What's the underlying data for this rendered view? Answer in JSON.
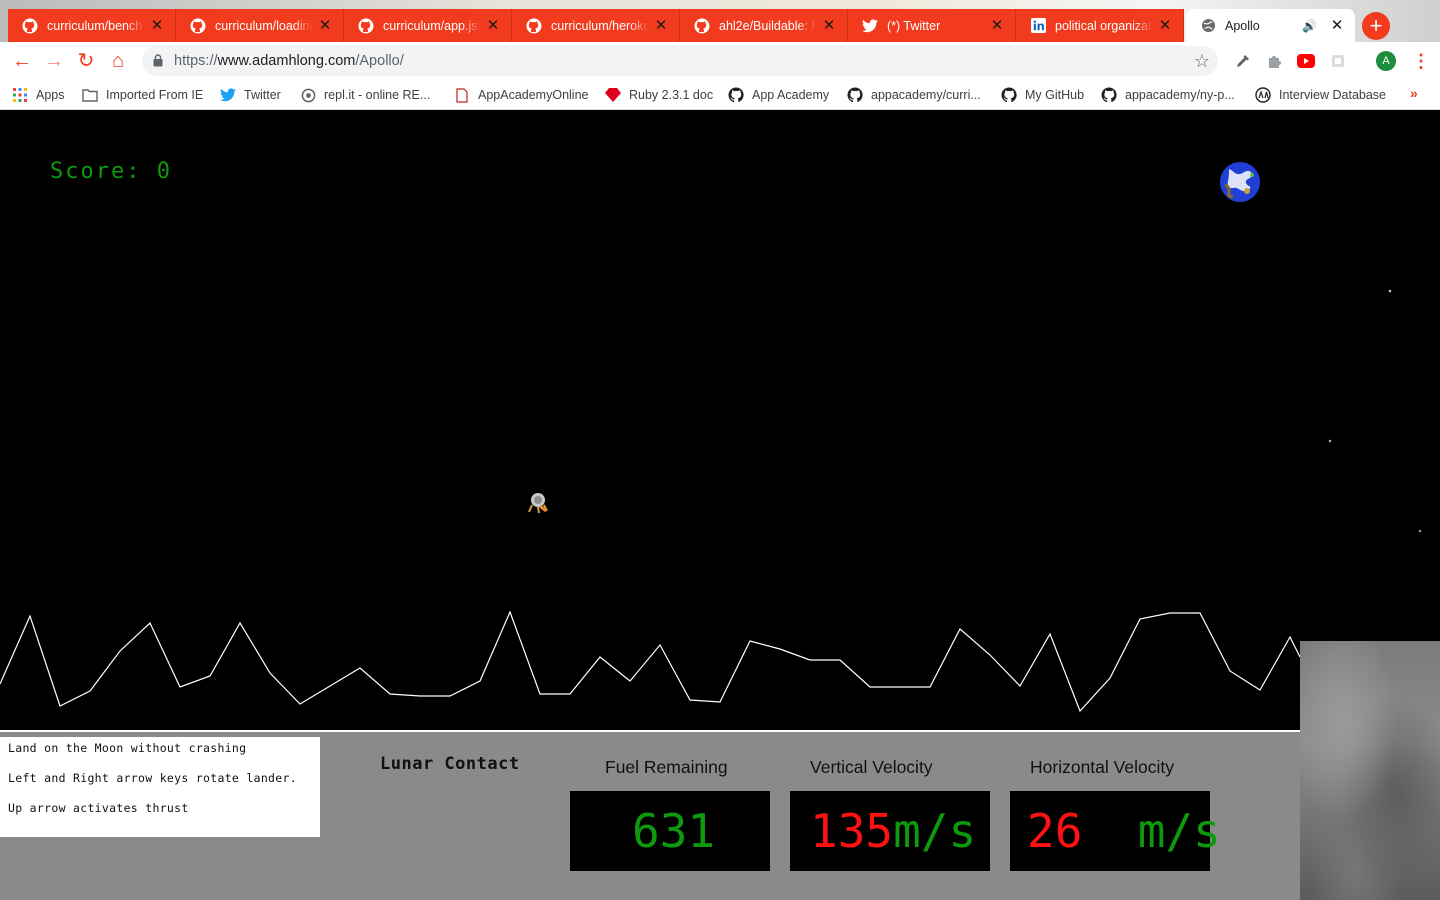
{
  "browser": {
    "tabs": [
      {
        "title": "curriculum/bench",
        "icon": "github-icon"
      },
      {
        "title": "curriculum/loading",
        "icon": "github-icon"
      },
      {
        "title": "curriculum/app.jsx",
        "icon": "github-icon"
      },
      {
        "title": "curriculum/heroku",
        "icon": "github-icon"
      },
      {
        "title": "ahl2e/Buildable: F",
        "icon": "github-icon"
      },
      {
        "title": "(*) Twitter",
        "icon": "twitter-icon"
      },
      {
        "title": "political organizati",
        "icon": "linkedin-icon"
      },
      {
        "title": "Apollo",
        "icon": "globe-icon",
        "active": true,
        "audio": true
      }
    ],
    "url_prefix": "https://",
    "url_host": "www.adamhlong.com",
    "url_path": "/Apollo/",
    "avatar_letter": "A",
    "bookmarks": [
      {
        "label": "Apps",
        "icon": "apps-grid-icon"
      },
      {
        "label": "Imported From IE",
        "icon": "folder-icon"
      },
      {
        "label": "Twitter",
        "icon": "twitter-icon"
      },
      {
        "label": "repl.it - online RE...",
        "icon": "replit-icon"
      },
      {
        "label": "AppAcademyOnline",
        "icon": "document-icon"
      },
      {
        "label": "Ruby 2.3.1 doc",
        "icon": "ruby-icon"
      },
      {
        "label": "App Academy",
        "icon": "github-icon"
      },
      {
        "label": "appacademy/curri...",
        "icon": "github-icon"
      },
      {
        "label": "My GitHub",
        "icon": "github-icon"
      },
      {
        "label": "appacademy/ny-p...",
        "icon": "github-icon"
      },
      {
        "label": "Interview Database",
        "icon": "aa-logo-icon"
      }
    ],
    "accent_color": "#f13a1e"
  },
  "game": {
    "score_label": "Score:",
    "score_value": "0",
    "instructions": [
      "Land on the Moon without crashing",
      "Left and Right arrow keys rotate lander.",
      "Up arrow activates thrust"
    ],
    "status": "Lunar Contact",
    "fuel": {
      "label": "Fuel Remaining",
      "value": "631"
    },
    "vertical_velocity": {
      "label": "Vertical Velocity",
      "value": "135",
      "unit": "m/s"
    },
    "horizontal_velocity": {
      "label": "Horizontal Velocity",
      "value": "26",
      "unit": "m/s"
    },
    "colors": {
      "ok": "#0d9a0d",
      "danger": "#ff1111",
      "panel": "#8a8a8a"
    }
  }
}
